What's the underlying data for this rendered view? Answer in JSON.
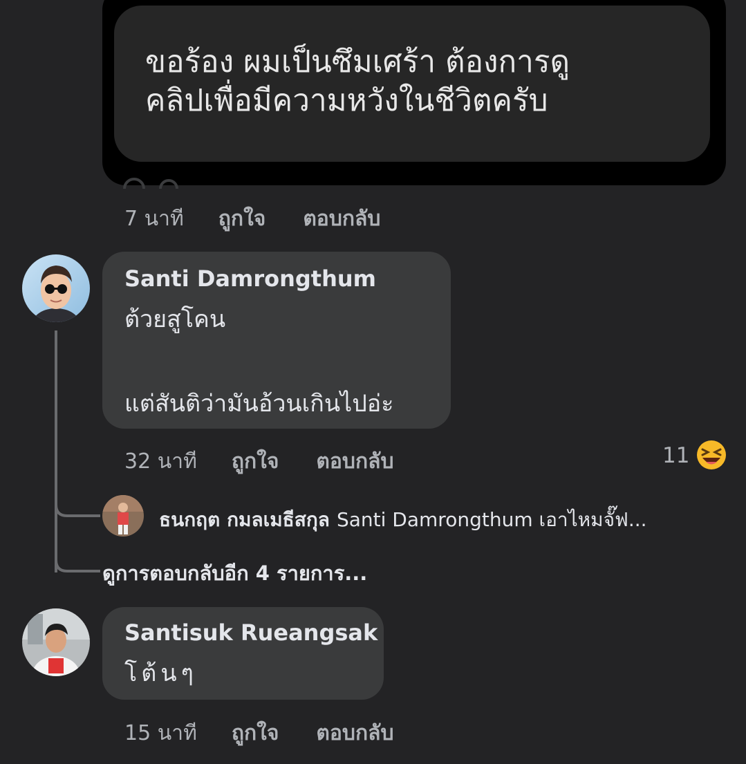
{
  "post": {
    "text": "ขอร้อง ผมเป็นซึมเศร้า ต้องการดู\nคลิปเพื่อมีความหวังในชีวิตครับ",
    "time": "7 นาที",
    "like": "ถูกใจ",
    "reply": "ตอบกลับ"
  },
  "comments": [
    {
      "author": "Santi Damrongthum",
      "line1": "ต้วยสูโคน",
      "line2": "แต่สันติว่ามันอ้วนเกินไปอ่ะ",
      "time": "32 นาที",
      "like": "ถูกใจ",
      "reply": "ตอบกลับ",
      "reaction_count": "11",
      "reply_preview": {
        "author": "ธนกฤต กมลเมธีสกุล",
        "text": "Santi Damrongthum เอาไหมจั๊ฟ..."
      },
      "more_replies": "ดูการตอบกลับอีก 4 รายการ..."
    },
    {
      "author": "Santisuk Rueangsak",
      "line1": "โต้นๆ",
      "time": "15 นาที",
      "like": "ถูกใจ",
      "reply": "ตอบกลับ"
    }
  ],
  "colors": {
    "background": "#232325",
    "bubble": "#3a3b3c",
    "meta_text": "#b0b3b8",
    "reaction_emoji": "#f7b928"
  }
}
